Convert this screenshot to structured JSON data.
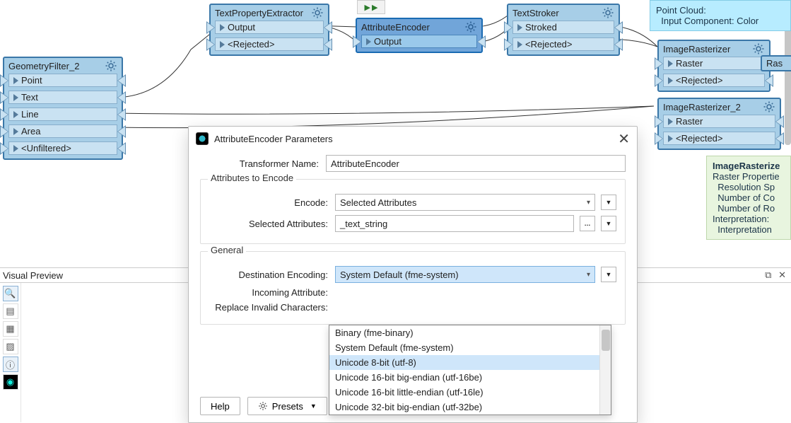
{
  "nodes": {
    "geom": {
      "title": "GeometryFilter_2",
      "ports": [
        "Point",
        "Text",
        "Line",
        "Area",
        "<Unfiltered>"
      ]
    },
    "tpe": {
      "title": "TextPropertyExtractor",
      "ports": [
        "Output",
        "<Rejected>"
      ]
    },
    "ae": {
      "title": "AttributeEncoder",
      "ports": [
        "Output"
      ]
    },
    "ts": {
      "title": "TextStroker",
      "ports": [
        "Stroked",
        "<Rejected>"
      ]
    },
    "ir": {
      "title": "ImageRasterizer",
      "ports": [
        "Raster",
        "<Rejected>"
      ]
    },
    "ir2": {
      "title": "ImageRasterizer_2",
      "ports": [
        "Raster",
        "<Rejected>"
      ]
    },
    "ras": {
      "title": "Ras"
    }
  },
  "bookmark1": {
    "l1": "Point Cloud:",
    "l2": "  Input Component: Color"
  },
  "bookmark2": {
    "l1": "ImageRasterize",
    "l2": "Raster Propertie",
    "l3": "  Resolution Sp",
    "l4": "  Number of Co",
    "l5": "  Number of Ro",
    "l6": "Interpretation:",
    "l7": "  Interpretation"
  },
  "panel": {
    "title": "Visual Preview"
  },
  "dialog": {
    "title": "AttributeEncoder Parameters",
    "transformer_label": "Transformer Name:",
    "transformer_value": "AttributeEncoder",
    "section1": "Attributes to Encode",
    "encode_label": "Encode:",
    "encode_value": "Selected Attributes",
    "selattr_label": "Selected Attributes:",
    "selattr_value": "_text_string",
    "section2": "General",
    "dest_label": "Destination Encoding:",
    "dest_value": "System Default (fme-system)",
    "incoming_label": "Incoming Attribute:",
    "replace_label": "Replace Invalid Characters:",
    "help": "Help",
    "presets": "Presets"
  },
  "dd": {
    "items": [
      "Binary (fme-binary)",
      "System Default (fme-system)",
      "Unicode 8-bit (utf-8)",
      "Unicode 16-bit big-endian (utf-16be)",
      "Unicode 16-bit little-endian (utf-16le)",
      "Unicode 32-bit big-endian (utf-32be)"
    ],
    "hover_index": 2
  }
}
